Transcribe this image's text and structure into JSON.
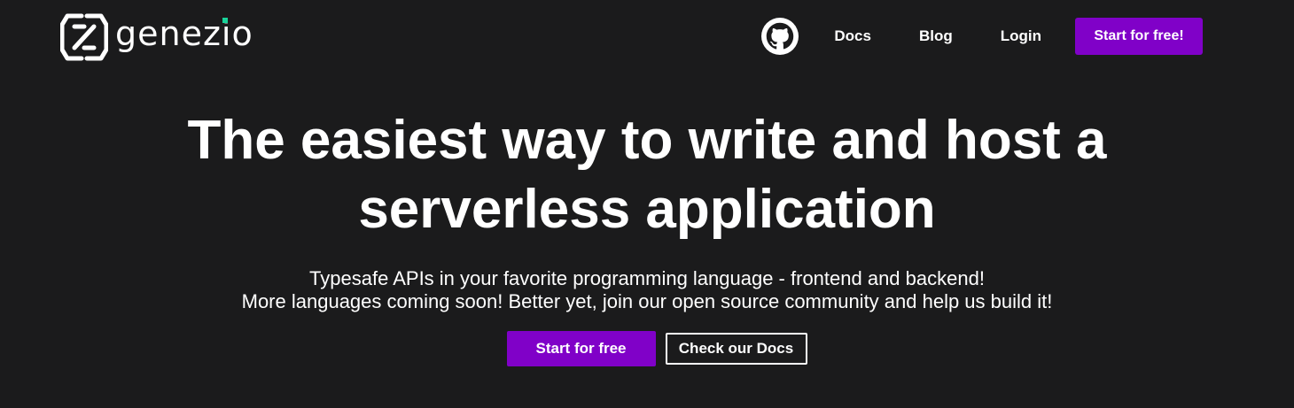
{
  "brand": {
    "name": "genezio",
    "logo_icon": "genezio-logo-icon",
    "accent_dot_color": "#19d39a"
  },
  "nav": {
    "github_icon": "github-icon",
    "links": [
      "Docs",
      "Blog",
      "Login"
    ],
    "cta_label": "Start for free!"
  },
  "hero": {
    "title_line1": "The easiest way to write and host a",
    "title_line2": "serverless application",
    "subtitle_line1": "Typesafe APIs in your favorite programming language - frontend and backend!",
    "subtitle_line2": "More languages coming soon! Better yet, join our open source community and help us build it!",
    "primary_cta": "Start for free",
    "secondary_cta": "Check our Docs"
  },
  "colors": {
    "background": "#1b1b1c",
    "primary": "#8001c8",
    "text": "#ffffff"
  }
}
